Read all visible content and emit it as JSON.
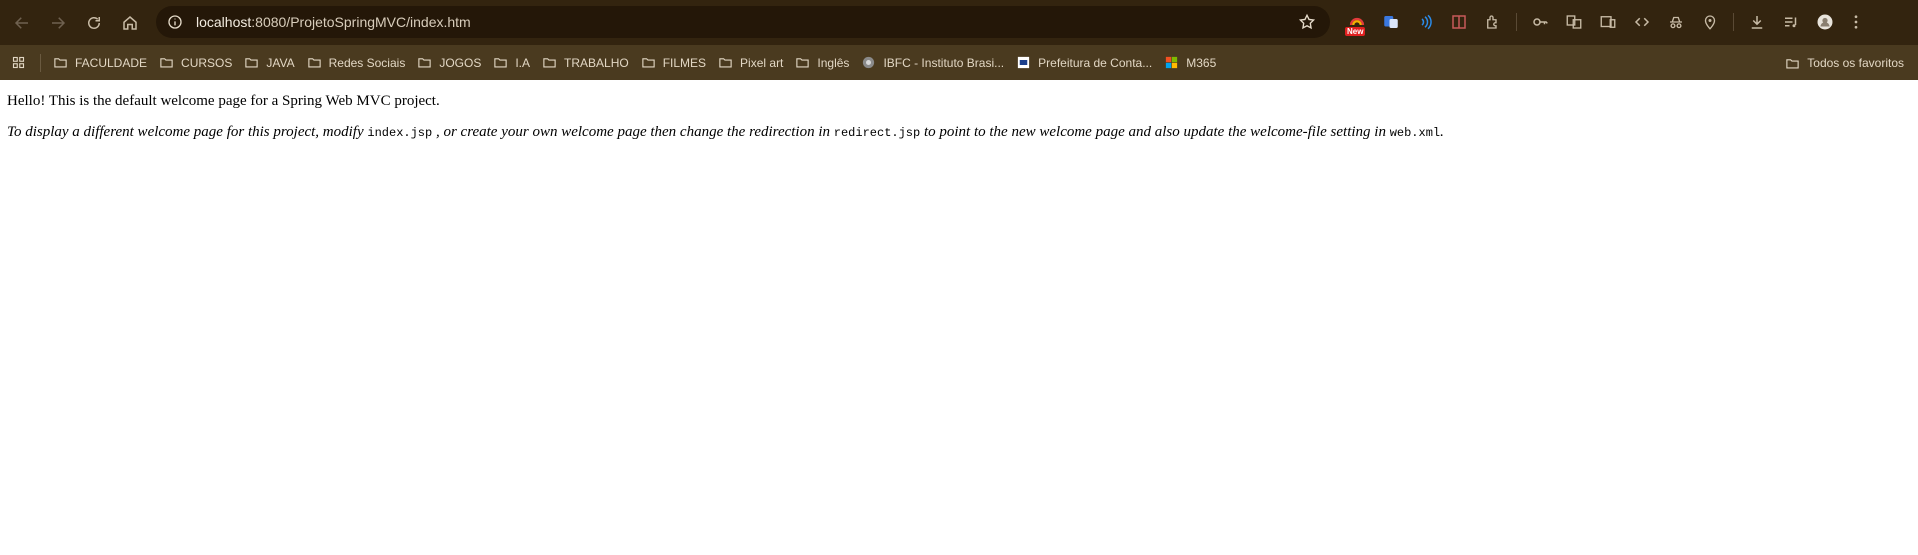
{
  "browser": {
    "url_host": "localhost",
    "url_rest": ":8080/ProjetoSpringMVC/index.htm",
    "new_badge": "New"
  },
  "bookmarks": {
    "items": [
      {
        "label": "FACULDADE",
        "icon": "folder-icon"
      },
      {
        "label": "CURSOS",
        "icon": "folder-icon"
      },
      {
        "label": "JAVA",
        "icon": "folder-icon"
      },
      {
        "label": "Redes Sociais",
        "icon": "folder-icon"
      },
      {
        "label": "JOGOS",
        "icon": "folder-icon"
      },
      {
        "label": "I.A",
        "icon": "folder-icon"
      },
      {
        "label": "TRABALHO",
        "icon": "folder-icon"
      },
      {
        "label": "FILMES",
        "icon": "folder-icon"
      },
      {
        "label": "Pixel art",
        "icon": "folder-icon"
      },
      {
        "label": "Inglês",
        "icon": "folder-icon"
      },
      {
        "label": "IBFC - Instituto Brasi...",
        "icon": "ibfc-favicon"
      },
      {
        "label": "Prefeitura de Conta...",
        "icon": "pci-favicon"
      },
      {
        "label": "M365",
        "icon": "microsoft-icon"
      }
    ],
    "all_bookmarks": "Todos os favoritos"
  },
  "page": {
    "line1": "Hello! This is the default welcome page for a Spring Web MVC project.",
    "line2_part1": "To display a different welcome page for this project, modify ",
    "code1": "index.jsp",
    "line2_part2": " , or create your own welcome page then change the redirection in ",
    "code2": "redirect.jsp",
    "line2_part3": " to point to the new welcome page and also update the welcome-file setting in ",
    "code3": "web.xml",
    "line2_part4": "."
  }
}
